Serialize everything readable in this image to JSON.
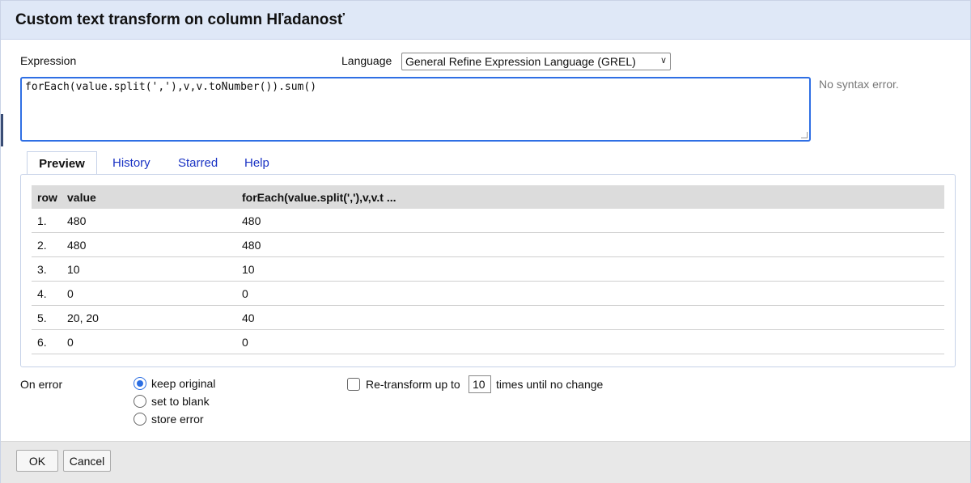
{
  "dialog": {
    "title": "Custom text transform on column Hľadanosť"
  },
  "expression": {
    "label": "Expression",
    "value": "forEach(value.split(','),v,v.toNumber()).sum()",
    "status": "No syntax error."
  },
  "language": {
    "label": "Language",
    "selected": "General Refine Expression Language (GREL)"
  },
  "tabs": [
    {
      "label": "Preview",
      "active": true
    },
    {
      "label": "History",
      "active": false
    },
    {
      "label": "Starred",
      "active": false
    },
    {
      "label": "Help",
      "active": false
    }
  ],
  "preview": {
    "headers": {
      "row": "row",
      "value": "value",
      "result": "forEach(value.split(','),v,v.t ..."
    },
    "rows": [
      {
        "row": "1.",
        "value": "480",
        "result": "480"
      },
      {
        "row": "2.",
        "value": "480",
        "result": "480"
      },
      {
        "row": "3.",
        "value": "10",
        "result": "10"
      },
      {
        "row": "4.",
        "value": "0",
        "result": "0"
      },
      {
        "row": "5.",
        "value": "20, 20",
        "result": "40"
      },
      {
        "row": "6.",
        "value": "0",
        "result": "0"
      }
    ]
  },
  "on_error": {
    "label": "On error",
    "options": [
      {
        "label": "keep original",
        "checked": true
      },
      {
        "label": "set to blank",
        "checked": false
      },
      {
        "label": "store error",
        "checked": false
      }
    ]
  },
  "retransform": {
    "checked": false,
    "prefix": "Re-transform up to",
    "times": "10",
    "suffix": "times until no change"
  },
  "buttons": {
    "ok": "OK",
    "cancel": "Cancel"
  },
  "colors": {
    "titlebar": "#dfe8f7",
    "accent": "#2b6ee2",
    "link": "#1a33c4",
    "table_header": "#dcdcdc"
  }
}
